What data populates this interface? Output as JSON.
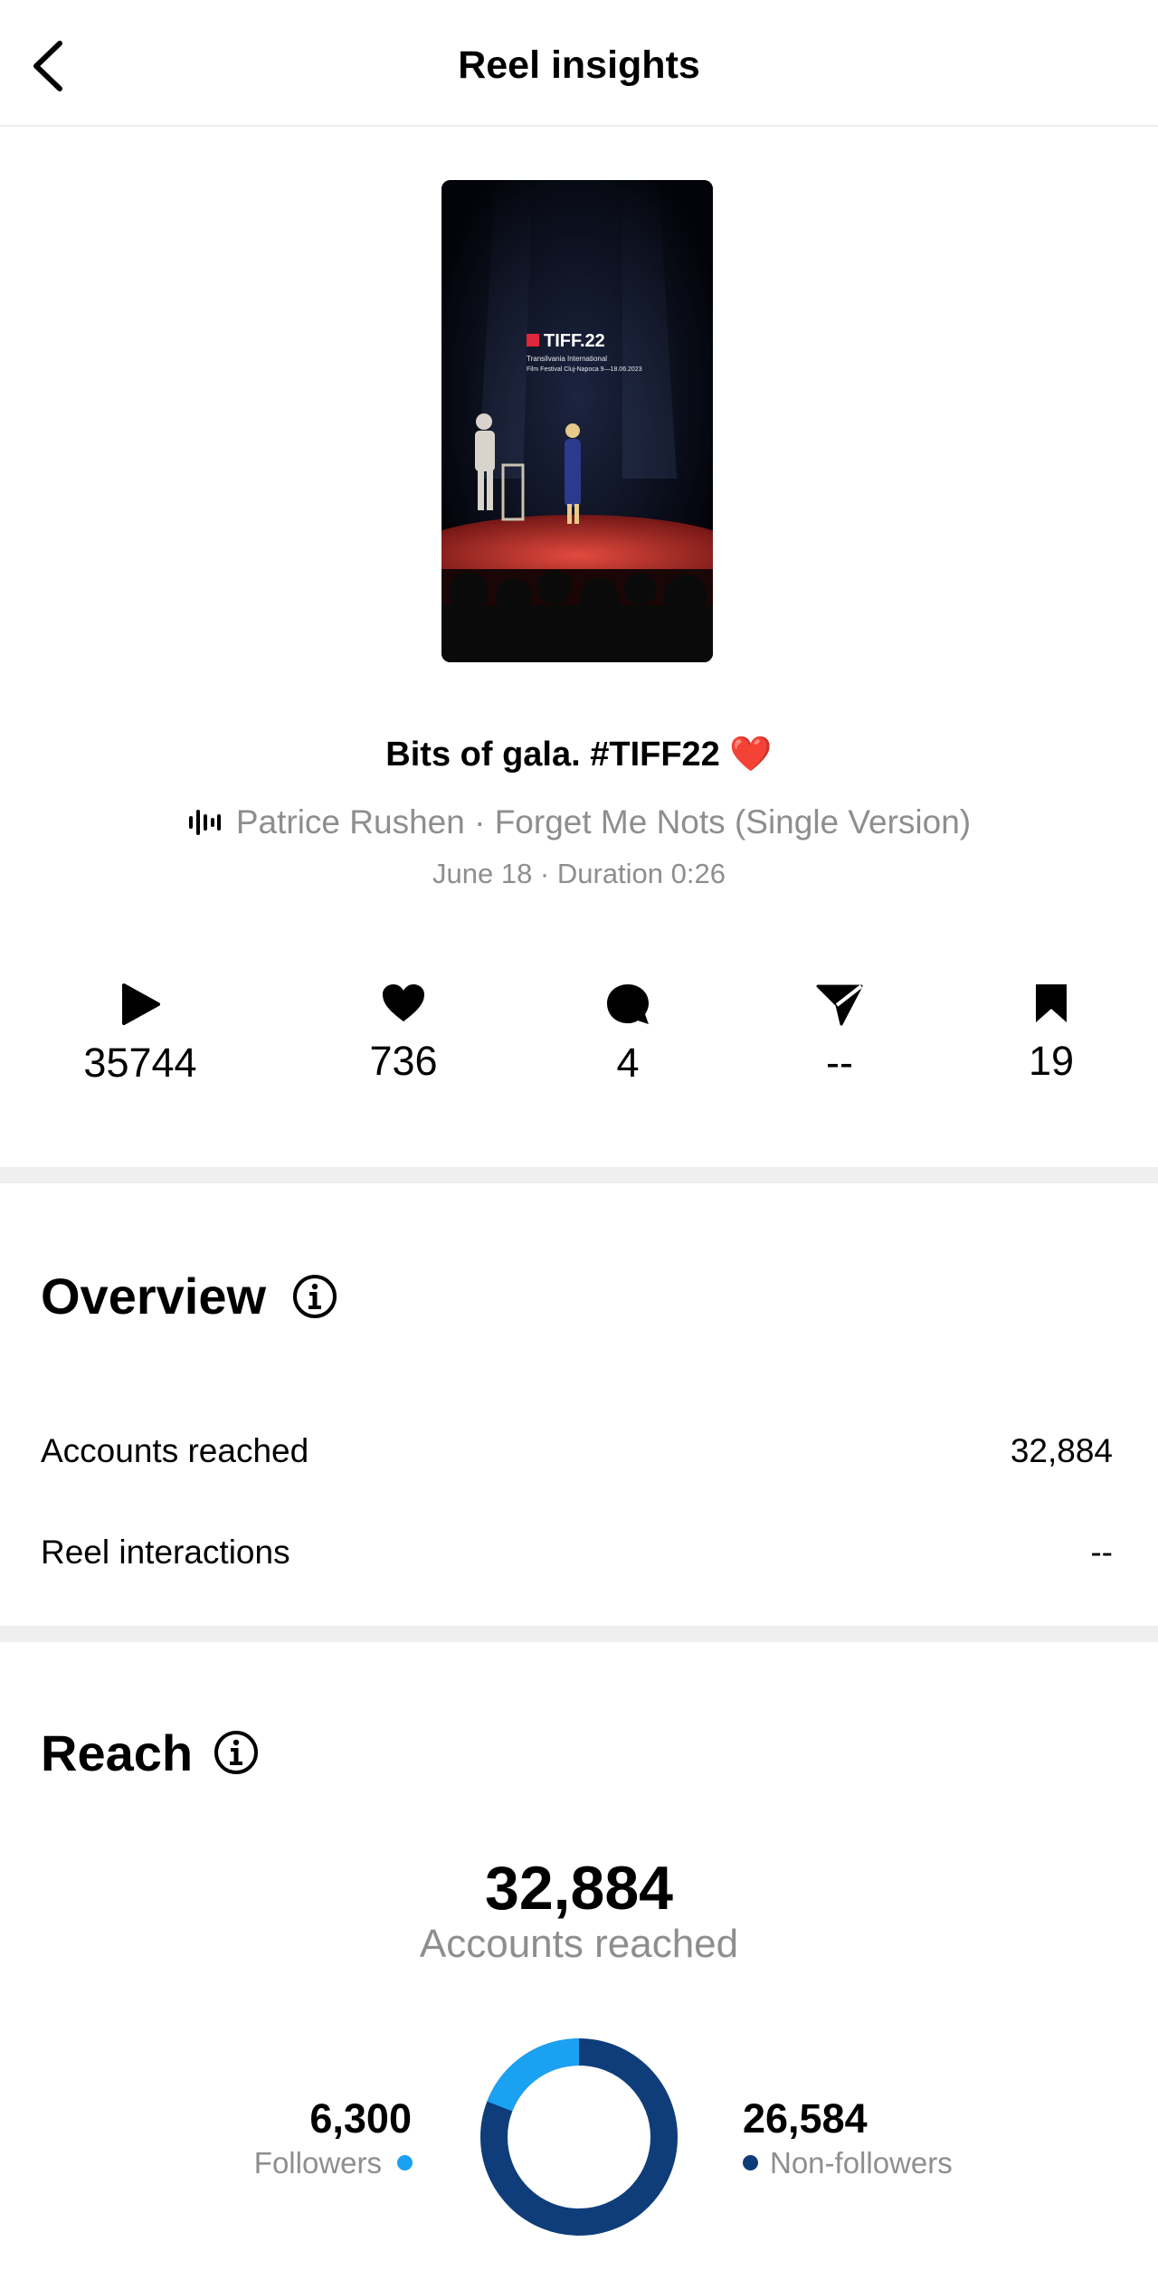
{
  "header": {
    "title": "Reel insights"
  },
  "reel": {
    "thumbnail_text": {
      "brand": "TIFF.22",
      "line1": "Transilvania International",
      "line2": "Film Festival Cluj-Napoca 9—18.06.2023"
    },
    "caption": "Bits of gala. #TIFF22 ❤️",
    "audio": "Patrice Rushen · Forget Me Nots (Single Version)",
    "meta": "June 18 · Duration 0:26"
  },
  "stats": [
    {
      "icon": "play-icon",
      "value": "35744"
    },
    {
      "icon": "heart-icon",
      "value": "736"
    },
    {
      "icon": "comment-icon",
      "value": "4"
    },
    {
      "icon": "share-icon",
      "value": "--"
    },
    {
      "icon": "save-icon",
      "value": "19"
    }
  ],
  "overview": {
    "title": "Overview",
    "rows": [
      {
        "label": "Accounts reached",
        "value": "32,884"
      },
      {
        "label": "Reel interactions",
        "value": "--"
      }
    ]
  },
  "reach": {
    "title": "Reach",
    "total": "32,884",
    "total_label": "Accounts reached",
    "followers": {
      "value": "6,300",
      "label": "Followers",
      "count": 6300,
      "color": "#1ba1f2"
    },
    "non_followers": {
      "value": "26,584",
      "label": "Non-followers",
      "count": 26584,
      "color": "#0f3d7a"
    }
  }
}
